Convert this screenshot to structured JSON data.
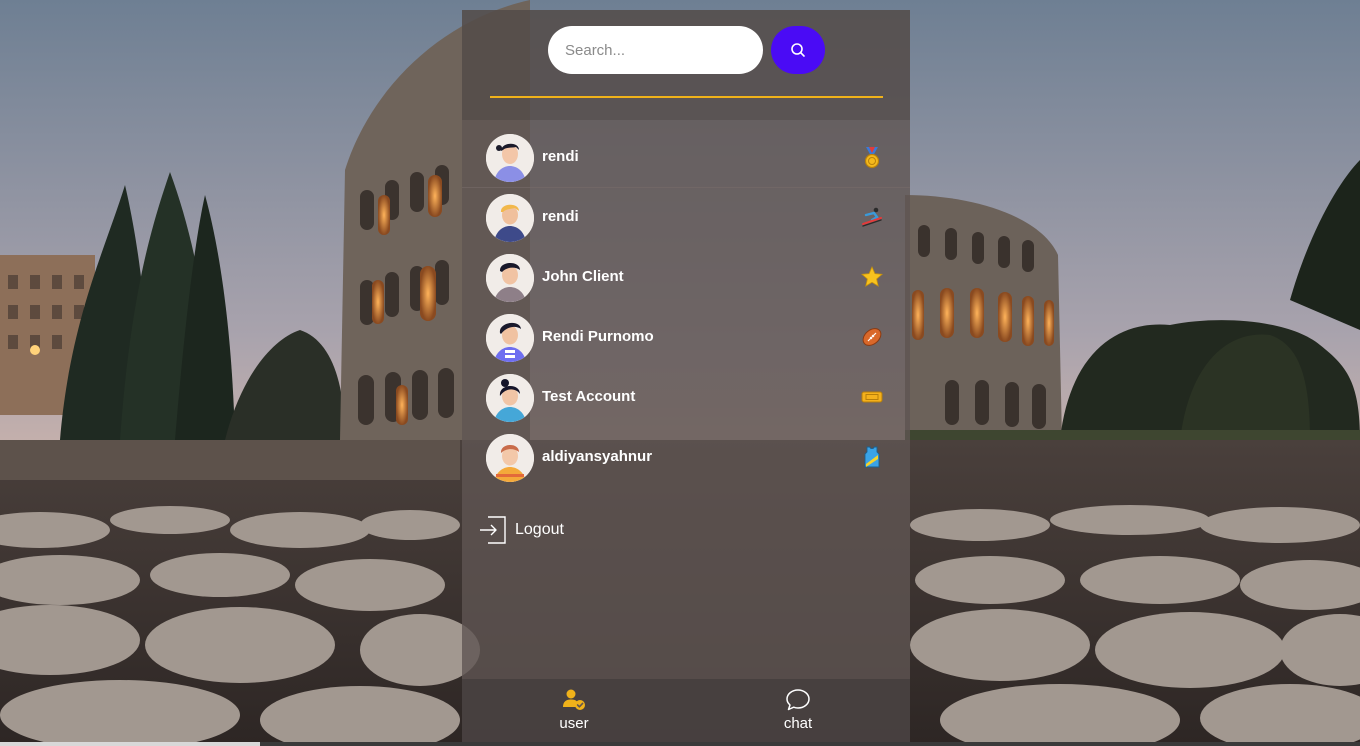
{
  "search": {
    "placeholder": "Search...",
    "button_icon": "search-icon"
  },
  "colors": {
    "accent": "#4a0bf5",
    "divider": "#f0b21a",
    "panel": "#5f5552"
  },
  "users": [
    {
      "name": "rendi",
      "badge": "medal-icon"
    },
    {
      "name": "rendi",
      "badge": "skier-icon"
    },
    {
      "name": "John Client",
      "badge": "star-icon"
    },
    {
      "name": "Rendi Purnomo",
      "badge": "rugby-ball-icon"
    },
    {
      "name": "Test Account",
      "badge": "ticket-icon"
    },
    {
      "name": "aldiyansyahnur",
      "badge": "jersey-icon"
    }
  ],
  "logout": {
    "label": "Logout",
    "icon": "logout-icon"
  },
  "nav": {
    "user": {
      "label": "user",
      "icon": "user-check-icon"
    },
    "chat": {
      "label": "chat",
      "icon": "chat-bubble-icon"
    }
  }
}
